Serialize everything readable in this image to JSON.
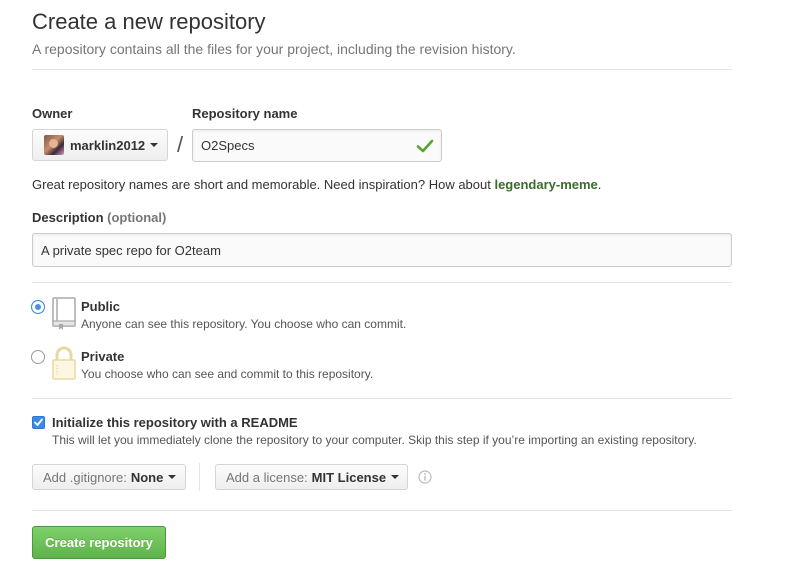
{
  "header": {
    "title": "Create a new repository",
    "subtitle": "A repository contains all the files for your project, including the revision history."
  },
  "owner": {
    "label": "Owner",
    "value": "marklin2012"
  },
  "repo_name": {
    "label": "Repository name",
    "value": "O2Specs",
    "separator": "/"
  },
  "hint": {
    "text": "Great repository names are short and memorable. Need inspiration? How about ",
    "suggestion": "legendary-meme",
    "end": "."
  },
  "description": {
    "label": "Description",
    "optional": "(optional)",
    "value": "A private spec repo for O2team"
  },
  "visibility": {
    "selected": "public",
    "options": [
      {
        "id": "public",
        "title": "Public",
        "desc": "Anyone can see this repository. You choose who can commit."
      },
      {
        "id": "private",
        "title": "Private",
        "desc": "You choose who can see and commit to this repository."
      }
    ]
  },
  "init": {
    "checked": true,
    "label": "Initialize this repository with a README",
    "desc": "This will let you immediately clone the repository to your computer. Skip this step if you’re importing an existing repository."
  },
  "gitignore": {
    "prefix": "Add .gitignore:",
    "value": "None"
  },
  "license": {
    "prefix": "Add a license:",
    "value": "MIT License"
  },
  "create_button": "Create repository",
  "colors": {
    "accent_green": "#5fb34a",
    "check_green": "#55a532",
    "suggestion_green": "#3a6c2b",
    "radio_blue": "#4a90e2"
  },
  "icons": [
    "check-icon",
    "book-icon",
    "lock-icon",
    "info-icon",
    "chevron-down-icon"
  ]
}
